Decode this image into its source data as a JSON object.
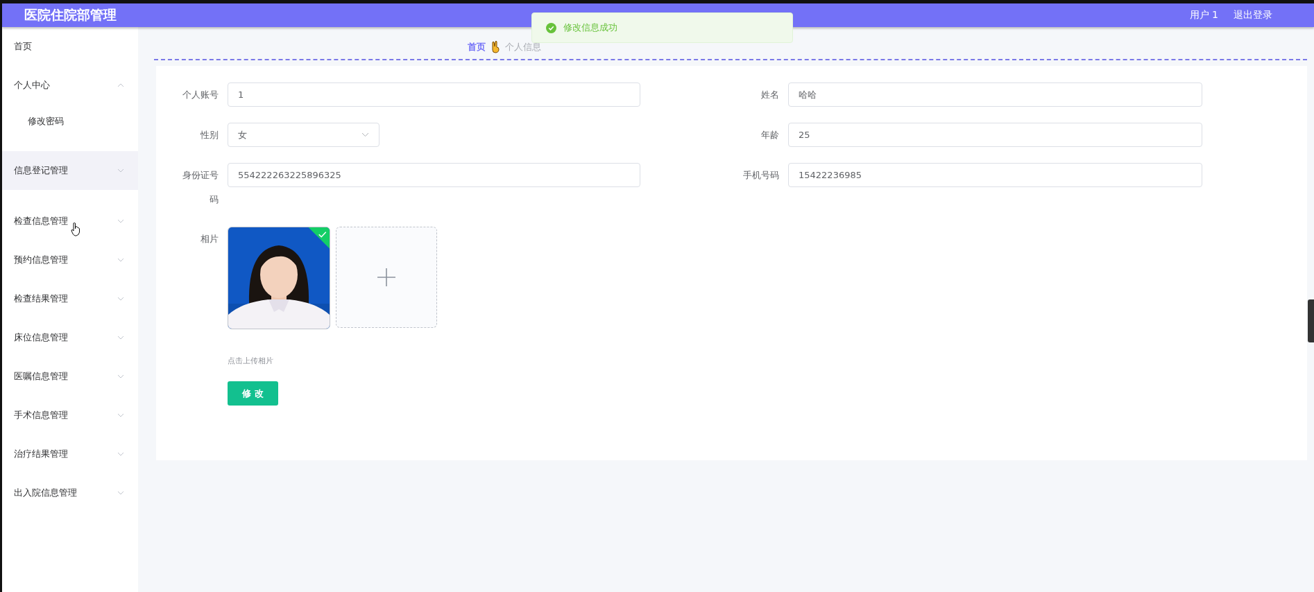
{
  "header": {
    "title": "医院住院部管理",
    "user": "用户 1",
    "logout": "退出登录"
  },
  "sidebar": {
    "items": [
      {
        "label": "首页",
        "kind": "link",
        "hovered": false
      },
      {
        "label": "个人中心",
        "kind": "menu",
        "expanded": true,
        "hovered": false,
        "children": [
          {
            "label": "修改密码"
          }
        ]
      },
      {
        "label": "信息登记管理",
        "kind": "menu",
        "expanded": false,
        "hovered": true
      },
      {
        "label": "检查信息管理",
        "kind": "menu",
        "expanded": false,
        "hovered": false
      },
      {
        "label": "预约信息管理",
        "kind": "menu",
        "expanded": false,
        "hovered": false
      },
      {
        "label": "检查结果管理",
        "kind": "menu",
        "expanded": false,
        "hovered": false
      },
      {
        "label": "床位信息管理",
        "kind": "menu",
        "expanded": false,
        "hovered": false
      },
      {
        "label": "医嘱信息管理",
        "kind": "menu",
        "expanded": false,
        "hovered": false
      },
      {
        "label": "手术信息管理",
        "kind": "menu",
        "expanded": false,
        "hovered": false
      },
      {
        "label": "治疗结果管理",
        "kind": "menu",
        "expanded": false,
        "hovered": false
      },
      {
        "label": "出入院信息管理",
        "kind": "menu",
        "expanded": false,
        "hovered": false
      }
    ]
  },
  "breadcrumb": [
    "首页",
    "个人信息"
  ],
  "toast": {
    "message": "修改信息成功"
  },
  "form": {
    "fields": [
      {
        "label": "个人账号",
        "value": "1",
        "kind": "input"
      },
      {
        "label": "姓名",
        "value": "哈哈",
        "kind": "input"
      },
      {
        "label": "性别",
        "value": "女",
        "kind": "select"
      },
      {
        "label": "年龄",
        "value": "25",
        "kind": "input"
      },
      {
        "label": "身份证号码",
        "value": "554222263225896325",
        "kind": "input"
      },
      {
        "label": "手机号码",
        "value": "15422236985",
        "kind": "input"
      }
    ],
    "photo": {
      "label": "相片",
      "uploaded": true,
      "hint": "点击上传相片"
    },
    "submit": "修 改"
  }
}
